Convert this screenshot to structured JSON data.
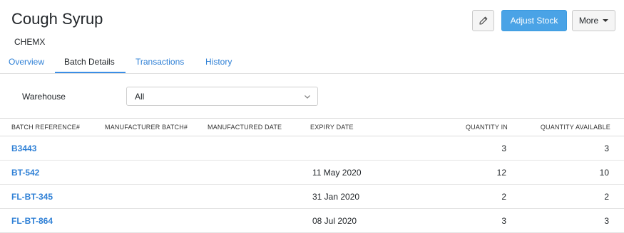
{
  "item": {
    "title": "Cough Syrup",
    "subtitle": "CHEMX"
  },
  "toolbar": {
    "adjust_stock": "Adjust Stock",
    "more": "More",
    "edit_icon": "pencil-icon"
  },
  "tabs": [
    {
      "label": "Overview",
      "active": false
    },
    {
      "label": "Batch Details",
      "active": true
    },
    {
      "label": "Transactions",
      "active": false
    },
    {
      "label": "History",
      "active": false
    }
  ],
  "filter": {
    "label": "Warehouse",
    "value": "All"
  },
  "table": {
    "headers": [
      "BATCH REFERENCE#",
      "MANUFACTURER BATCH#",
      "MANUFACTURED DATE",
      "EXPIRY DATE",
      "QUANTITY IN",
      "QUANTITY AVAILABLE"
    ],
    "rows": [
      {
        "batch_ref": "B3443",
        "manufacturer_batch": "",
        "manufactured_date": "",
        "expiry_date": "",
        "quantity_in": "3",
        "quantity_available": "3"
      },
      {
        "batch_ref": "BT-542",
        "manufacturer_batch": "",
        "manufactured_date": "",
        "expiry_date": "11 May 2020",
        "quantity_in": "12",
        "quantity_available": "10"
      },
      {
        "batch_ref": "FL-BT-345",
        "manufacturer_batch": "",
        "manufactured_date": "",
        "expiry_date": "31 Jan 2020",
        "quantity_in": "2",
        "quantity_available": "2"
      },
      {
        "batch_ref": "FL-BT-864",
        "manufacturer_batch": "",
        "manufactured_date": "",
        "expiry_date": "08 Jul 2020",
        "quantity_in": "3",
        "quantity_available": "3"
      }
    ]
  },
  "colors": {
    "accent": "#4aa3e6",
    "link": "#2f80d6"
  }
}
